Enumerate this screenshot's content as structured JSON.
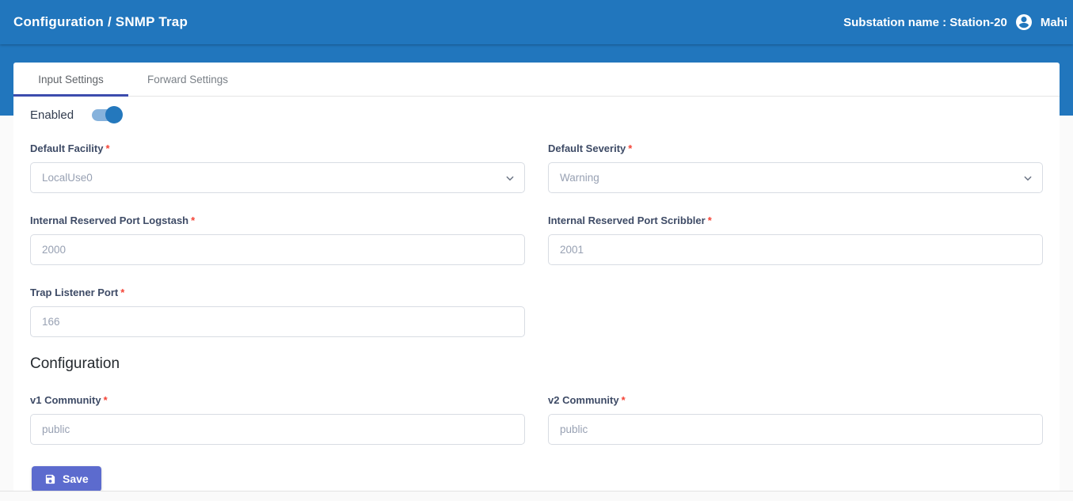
{
  "header": {
    "title": "Configuration / SNMP Trap",
    "substation_label": "Substation name : Station-20",
    "user_name": "Mahi"
  },
  "tabs": [
    {
      "label": "Input Settings",
      "active": true
    },
    {
      "label": "Forward Settings",
      "active": false
    }
  ],
  "enabled_toggle": {
    "label": "Enabled",
    "state": "on"
  },
  "form": {
    "required_marker": "*",
    "fields": [
      {
        "label": "Default Facility",
        "type": "select",
        "value": "LocalUse0"
      },
      {
        "label": "Default Severity",
        "type": "select",
        "value": "Warning"
      },
      {
        "label": "Internal Reserved Port Logstash",
        "type": "input",
        "value": "2000"
      },
      {
        "label": "Internal Reserved Port Scribbler",
        "type": "input",
        "value": "2001"
      },
      {
        "label": "Trap Listener Port",
        "type": "input",
        "value": "166"
      }
    ],
    "section_heading": "Configuration",
    "community_fields": [
      {
        "label": "v1 Community",
        "value": "public"
      },
      {
        "label": "v2 Community",
        "value": "public"
      }
    ],
    "save_button": {
      "label": "Save"
    }
  },
  "colors": {
    "header_blue": "#2176bd",
    "tab_underline_indigo": "#3c4cad",
    "save_button_indigo": "#5c6bce",
    "label_navy": "#3e4b66",
    "required_red": "#f44336",
    "placeholder_gray": "#98a1b3",
    "toggle_track": "#86b2dc",
    "toggle_knob": "#2478bd"
  }
}
